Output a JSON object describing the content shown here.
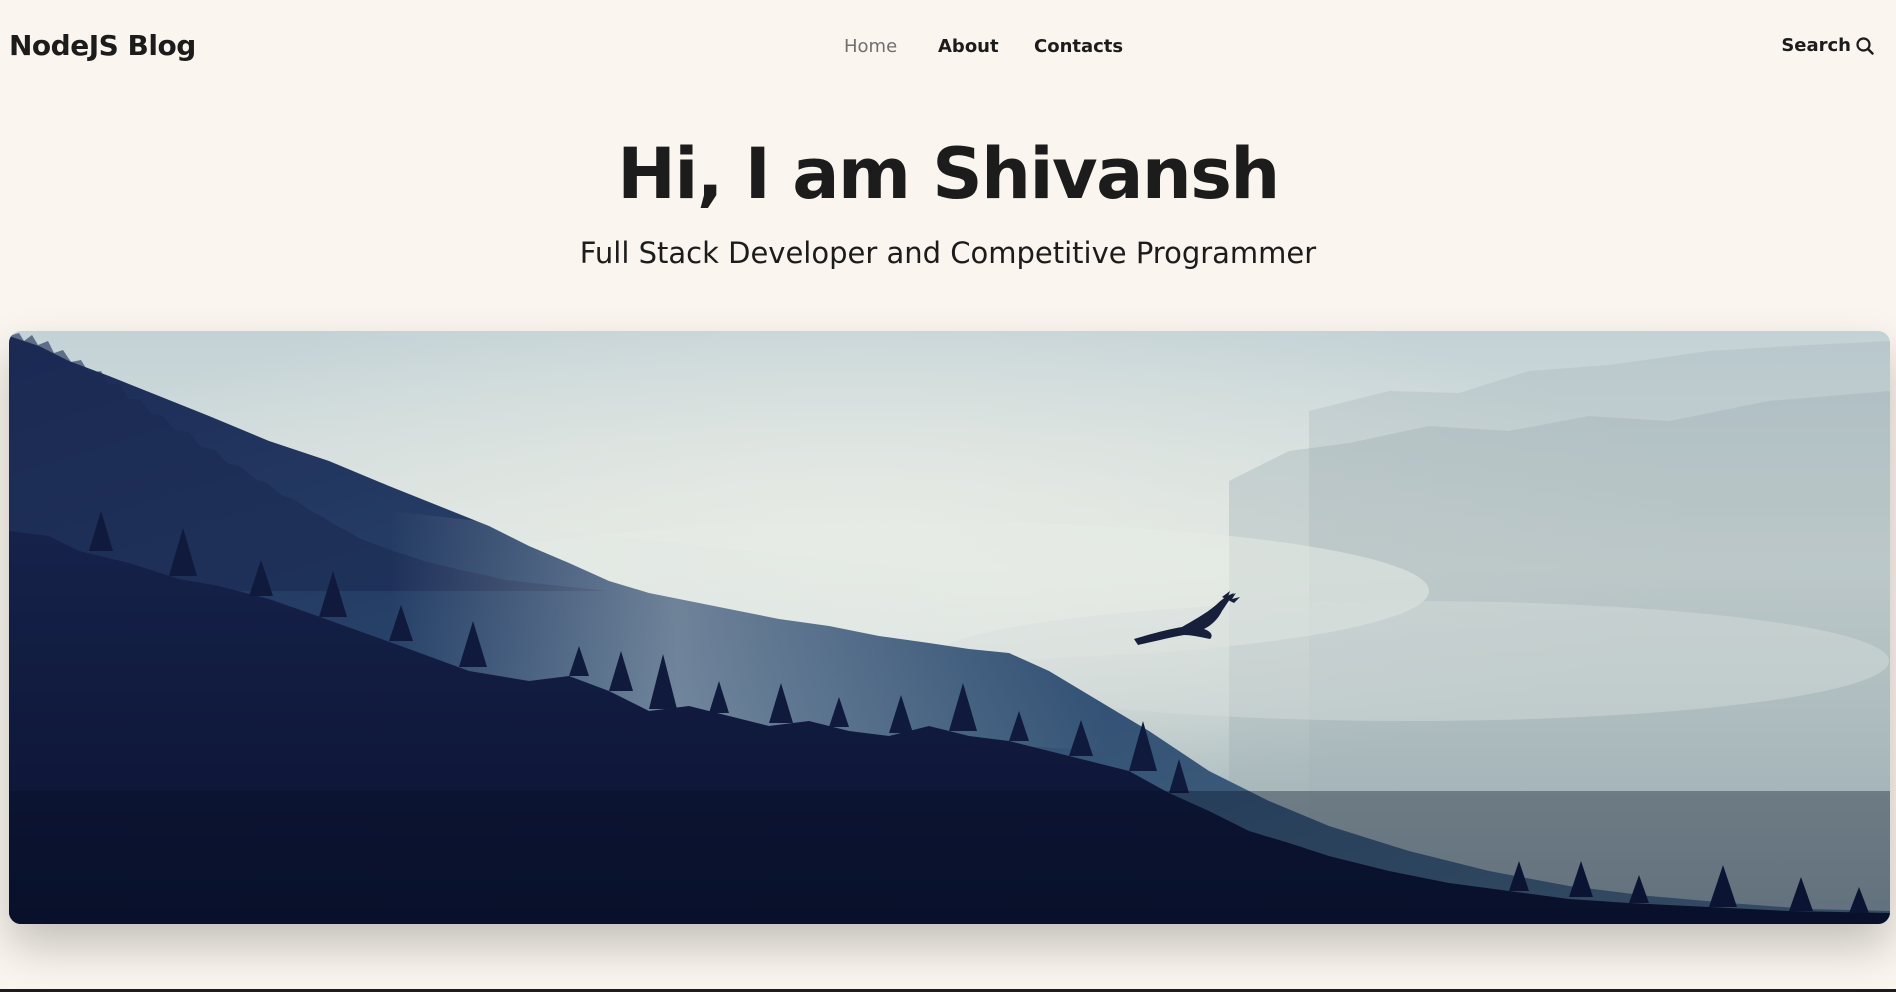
{
  "header": {
    "logo": "NodeJS Blog",
    "nav": [
      {
        "label": "Home",
        "active": true
      },
      {
        "label": "About",
        "active": false
      },
      {
        "label": "Contacts",
        "active": false
      }
    ],
    "search_label": "Search",
    "search_icon": "search-icon"
  },
  "hero": {
    "title": "Hi, I am Shivansh",
    "subtitle": "Full Stack Developer and Competitive Programmer",
    "image": "misty-forest-mountain-with-eagle"
  },
  "colors": {
    "background": "#faf5ee",
    "text": "#1c1c1c",
    "nav_active": "#6f6f6f"
  }
}
